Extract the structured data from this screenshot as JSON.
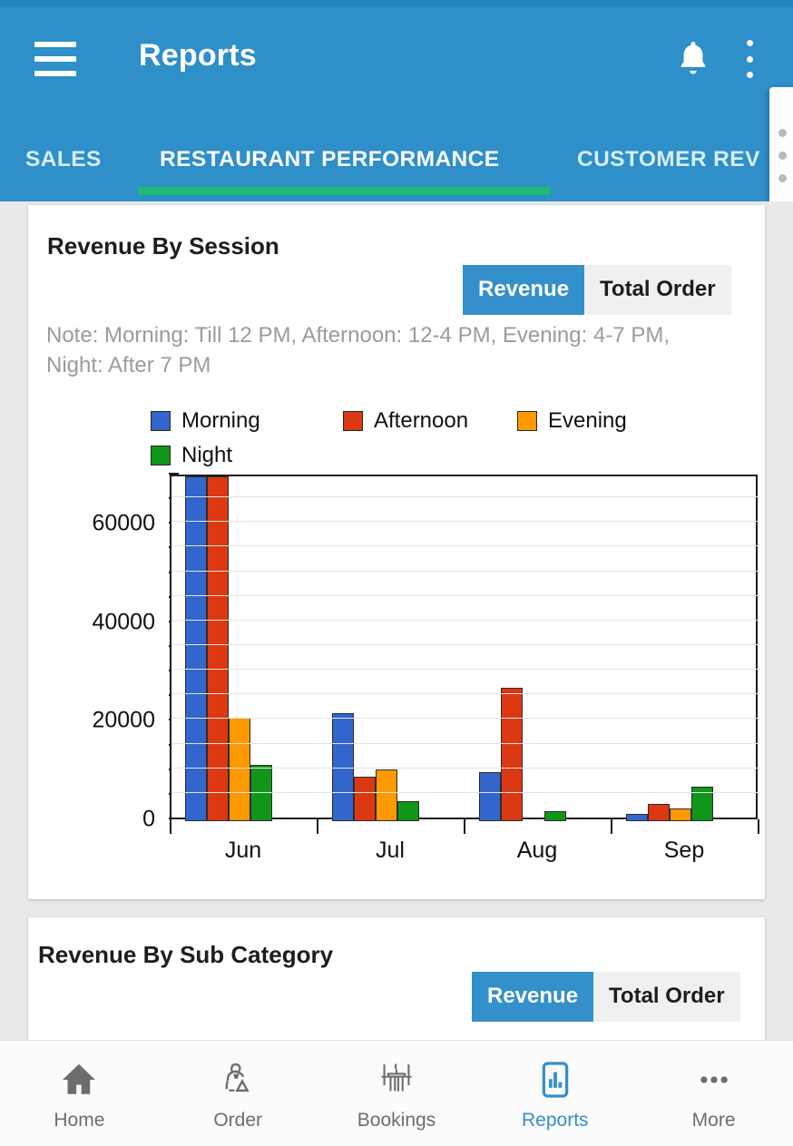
{
  "appbar": {
    "title": "Reports",
    "menu_icon": "hamburger-menu-icon",
    "bell_icon": "notification-bell-icon",
    "overflow_icon": "more-vertical-icon",
    "bg_color": "#2e8fc9",
    "indicator_color": "#1dba73"
  },
  "tabs": [
    {
      "label": "SALES",
      "active": false
    },
    {
      "label": "RESTAURANT PERFORMANCE",
      "active": true
    },
    {
      "label": "CUSTOMER REV",
      "active": false
    }
  ],
  "cards": {
    "session": {
      "title": "Revenue By Session",
      "segmented": {
        "selected": "Revenue",
        "options": [
          "Revenue",
          "Total Order"
        ]
      },
      "note": "Note: Morning: Till 12 PM, Afternoon: 12-4 PM, Evening: 4-7 PM, Night: After 7 PM"
    },
    "subcategory": {
      "title": "Revenue By Sub Category",
      "segmented": {
        "selected": "Revenue",
        "options": [
          "Revenue",
          "Total Order"
        ]
      }
    }
  },
  "chart_data": {
    "type": "bar",
    "title": "Revenue By Session",
    "xlabel": "",
    "ylabel": "",
    "grid": true,
    "legend_position": "top",
    "ylim": [
      0,
      70000
    ],
    "yticks": [
      0,
      20000,
      40000,
      60000
    ],
    "ytick_labels": [
      "0",
      "20000",
      "40000",
      "60000"
    ],
    "minor_tick_step": 5000,
    "categories": [
      "Jun",
      "Jul",
      "Aug",
      "Sep"
    ],
    "series": [
      {
        "name": "Morning",
        "color": "#3366cc",
        "values": [
          70000,
          22000,
          10000,
          1500
        ]
      },
      {
        "name": "Afternoon",
        "color": "#dc3912",
        "values": [
          70000,
          9000,
          27000,
          3500
        ]
      },
      {
        "name": "Evening",
        "color": "#ff9900",
        "values": [
          21000,
          10500,
          0,
          2600
        ]
      },
      {
        "name": "Night",
        "color": "#109618",
        "values": [
          11500,
          4000,
          2000,
          7000
        ]
      }
    ]
  },
  "bottom_nav": [
    {
      "label": "Home",
      "icon": "home-icon",
      "active": false
    },
    {
      "label": "Order",
      "icon": "waiter-icon",
      "active": false
    },
    {
      "label": "Bookings",
      "icon": "table-icon",
      "active": false
    },
    {
      "label": "Reports",
      "icon": "bar-chart-icon",
      "active": true
    },
    {
      "label": "More",
      "icon": "ellipsis-icon",
      "active": false
    }
  ],
  "colors": {
    "accent": "#3490cb",
    "active_nav": "#3490cb",
    "note_text": "#9b9b9b"
  }
}
